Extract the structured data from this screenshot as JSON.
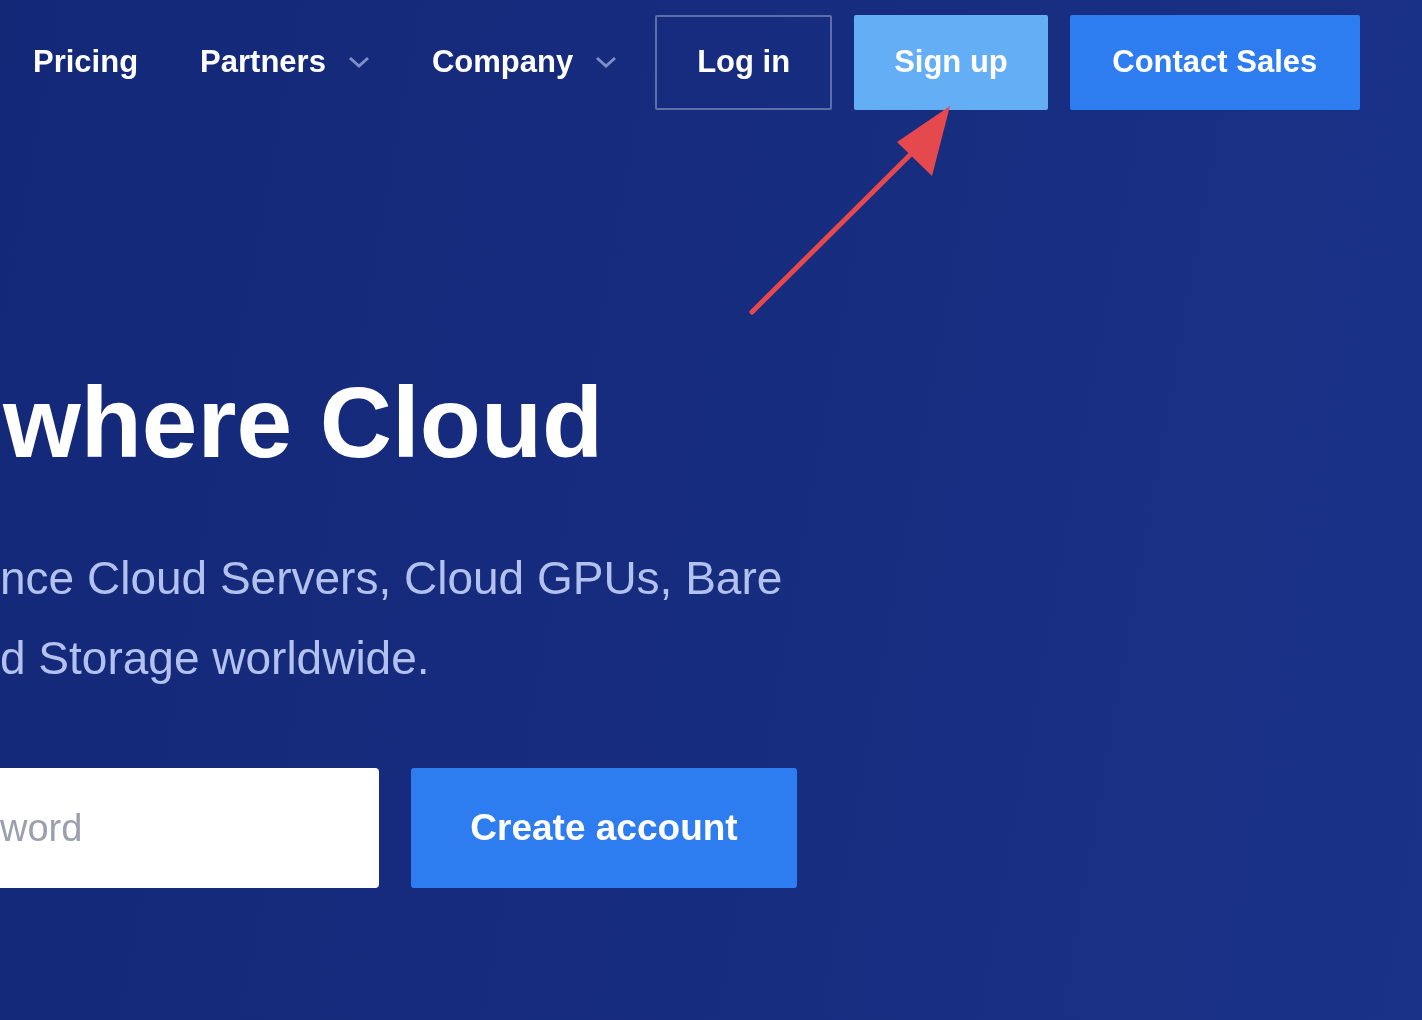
{
  "nav": {
    "links": [
      {
        "label": "Pricing",
        "dropdown": false
      },
      {
        "label": "Partners",
        "dropdown": true
      },
      {
        "label": "Company",
        "dropdown": true
      }
    ],
    "buttons": [
      {
        "label": "Log in",
        "kind": "outline"
      },
      {
        "label": "Sign up",
        "kind": "highlight"
      },
      {
        "label": "Contact Sales",
        "kind": "primary"
      }
    ]
  },
  "hero": {
    "headline": "where Cloud",
    "subtitle_lines": [
      "nce Cloud Servers, Cloud GPUs, Bare",
      "d Storage worldwide."
    ],
    "password": {
      "placeholder": "word"
    },
    "cta": "Create account"
  }
}
